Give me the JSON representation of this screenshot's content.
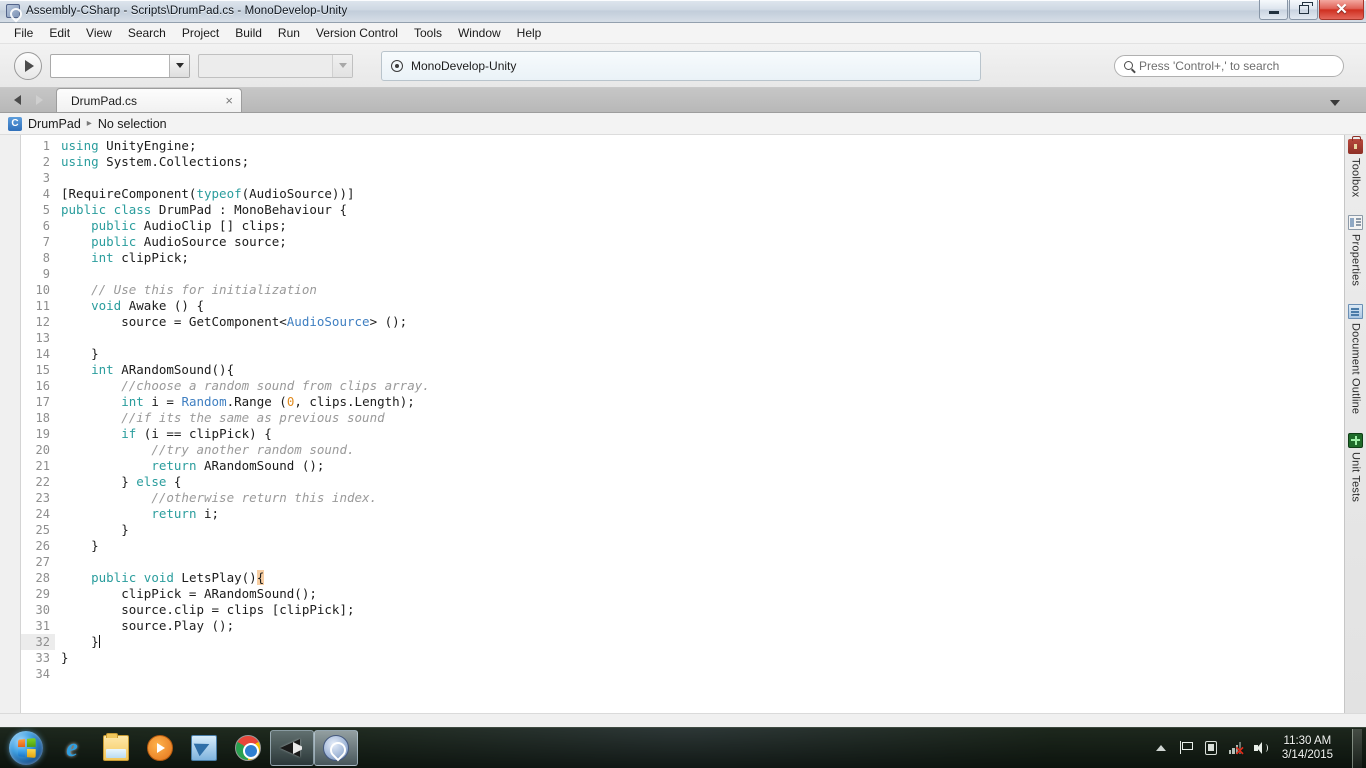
{
  "window": {
    "title": "Assembly-CSharp - Scripts\\DrumPad.cs - MonoDevelop-Unity",
    "icon": "monodevelop-icon",
    "minimize_label": "",
    "maximize_label": "",
    "close_label": "✕"
  },
  "menubar": {
    "items": [
      "File",
      "Edit",
      "View",
      "Search",
      "Project",
      "Build",
      "Run",
      "Version Control",
      "Tools",
      "Window",
      "Help"
    ]
  },
  "toolbar": {
    "run_button": "run-button",
    "configuration_combo": {
      "value": "",
      "enabled": true
    },
    "platform_combo": {
      "value": "",
      "enabled": false
    },
    "status_strip": {
      "icon": "target-icon",
      "text": "MonoDevelop-Unity"
    },
    "search": {
      "placeholder": "Press 'Control+,' to search",
      "value": "",
      "icon": "search-icon"
    }
  },
  "tabstrip": {
    "back_arrow": "navigate-back",
    "forward_arrow": "navigate-forward",
    "tabs": [
      {
        "label": "DrumPad.cs",
        "close": "×",
        "active": true
      }
    ],
    "overflow": "chevron-down-icon"
  },
  "breadcrumb": {
    "class_icon": "C",
    "class_name": "DrumPad",
    "separator": "▸",
    "member": "No selection"
  },
  "right_dock": {
    "items": [
      {
        "label": "Toolbox",
        "icon": "toolbox-icon"
      },
      {
        "label": "Properties",
        "icon": "properties-icon"
      },
      {
        "label": "Document Outline",
        "icon": "document-outline-icon"
      },
      {
        "label": "Unit Tests",
        "icon": "unit-tests-icon"
      }
    ]
  },
  "editor": {
    "current_line": 32,
    "total_lines": 34,
    "colors": {
      "keyword": "#2a9d9d",
      "type": "#3f7fc1",
      "number": "#e08a1e",
      "comment": "#9a9a9a",
      "text": "#1c1c1c",
      "brace_match_bg": "#f8cfa4",
      "background": "#ffffff",
      "line_number": "#8e8e8e"
    },
    "lines": [
      {
        "n": 1,
        "tokens": [
          {
            "t": "using",
            "c": "kw"
          },
          {
            "t": " UnityEngine;",
            "c": ""
          }
        ]
      },
      {
        "n": 2,
        "tokens": [
          {
            "t": "using",
            "c": "kw"
          },
          {
            "t": " System.Collections;",
            "c": ""
          }
        ]
      },
      {
        "n": 3,
        "tokens": []
      },
      {
        "n": 4,
        "tokens": [
          {
            "t": "[RequireComponent(",
            "c": ""
          },
          {
            "t": "typeof",
            "c": "kw"
          },
          {
            "t": "(AudioSource))]",
            "c": ""
          }
        ]
      },
      {
        "n": 5,
        "tokens": [
          {
            "t": "public class",
            "c": "kw"
          },
          {
            "t": " DrumPad : MonoBehaviour {",
            "c": ""
          }
        ]
      },
      {
        "n": 6,
        "tokens": [
          {
            "t": "    ",
            "c": ""
          },
          {
            "t": "public",
            "c": "kw"
          },
          {
            "t": " AudioClip [] clips;",
            "c": ""
          }
        ]
      },
      {
        "n": 7,
        "tokens": [
          {
            "t": "    ",
            "c": ""
          },
          {
            "t": "public",
            "c": "kw"
          },
          {
            "t": " AudioSource source;",
            "c": ""
          }
        ]
      },
      {
        "n": 8,
        "tokens": [
          {
            "t": "    ",
            "c": ""
          },
          {
            "t": "int",
            "c": "kw"
          },
          {
            "t": " clipPick;",
            "c": ""
          }
        ]
      },
      {
        "n": 9,
        "tokens": []
      },
      {
        "n": 10,
        "tokens": [
          {
            "t": "    ",
            "c": ""
          },
          {
            "t": "// Use this for initialization",
            "c": "cmt"
          }
        ]
      },
      {
        "n": 11,
        "tokens": [
          {
            "t": "    ",
            "c": ""
          },
          {
            "t": "void",
            "c": "kw"
          },
          {
            "t": " Awake () {",
            "c": ""
          }
        ]
      },
      {
        "n": 12,
        "tokens": [
          {
            "t": "        source = GetComponent<",
            "c": ""
          },
          {
            "t": "AudioSource",
            "c": "typ"
          },
          {
            "t": "> ();",
            "c": ""
          }
        ]
      },
      {
        "n": 13,
        "tokens": []
      },
      {
        "n": 14,
        "tokens": [
          {
            "t": "    }",
            "c": ""
          }
        ]
      },
      {
        "n": 15,
        "tokens": [
          {
            "t": "    ",
            "c": ""
          },
          {
            "t": "int",
            "c": "kw"
          },
          {
            "t": " ARandomSound(){",
            "c": ""
          }
        ]
      },
      {
        "n": 16,
        "tokens": [
          {
            "t": "        ",
            "c": ""
          },
          {
            "t": "//choose a random sound from clips array.",
            "c": "cmt"
          }
        ]
      },
      {
        "n": 17,
        "tokens": [
          {
            "t": "        ",
            "c": ""
          },
          {
            "t": "int",
            "c": "kw"
          },
          {
            "t": " i = ",
            "c": ""
          },
          {
            "t": "Random",
            "c": "typ"
          },
          {
            "t": ".Range (",
            "c": ""
          },
          {
            "t": "0",
            "c": "num"
          },
          {
            "t": ", clips.Length);",
            "c": ""
          }
        ]
      },
      {
        "n": 18,
        "tokens": [
          {
            "t": "        ",
            "c": ""
          },
          {
            "t": "//if its the same as previous sound",
            "c": "cmt"
          }
        ]
      },
      {
        "n": 19,
        "tokens": [
          {
            "t": "        ",
            "c": ""
          },
          {
            "t": "if",
            "c": "kw"
          },
          {
            "t": " (i == clipPick) {",
            "c": ""
          }
        ]
      },
      {
        "n": 20,
        "tokens": [
          {
            "t": "            ",
            "c": ""
          },
          {
            "t": "//try another random sound.",
            "c": "cmt"
          }
        ]
      },
      {
        "n": 21,
        "tokens": [
          {
            "t": "            ",
            "c": ""
          },
          {
            "t": "return",
            "c": "kw"
          },
          {
            "t": " ARandomSound ();",
            "c": ""
          }
        ]
      },
      {
        "n": 22,
        "tokens": [
          {
            "t": "        } ",
            "c": ""
          },
          {
            "t": "else",
            "c": "kw"
          },
          {
            "t": " {",
            "c": ""
          }
        ]
      },
      {
        "n": 23,
        "tokens": [
          {
            "t": "            ",
            "c": ""
          },
          {
            "t": "//otherwise return this index.",
            "c": "cmt"
          }
        ]
      },
      {
        "n": 24,
        "tokens": [
          {
            "t": "            ",
            "c": ""
          },
          {
            "t": "return",
            "c": "kw"
          },
          {
            "t": " i;",
            "c": ""
          }
        ]
      },
      {
        "n": 25,
        "tokens": [
          {
            "t": "        }",
            "c": ""
          }
        ]
      },
      {
        "n": 26,
        "tokens": [
          {
            "t": "    }",
            "c": ""
          }
        ]
      },
      {
        "n": 27,
        "tokens": []
      },
      {
        "n": 28,
        "tokens": [
          {
            "t": "    ",
            "c": ""
          },
          {
            "t": "public void",
            "c": "kw"
          },
          {
            "t": " LetsPlay()",
            "c": ""
          },
          {
            "t": "{",
            "c": "brc"
          }
        ]
      },
      {
        "n": 29,
        "tokens": [
          {
            "t": "        clipPick = ARandomSound();",
            "c": ""
          }
        ]
      },
      {
        "n": 30,
        "tokens": [
          {
            "t": "        source.clip = clips [clipPick];",
            "c": ""
          }
        ]
      },
      {
        "n": 31,
        "tokens": [
          {
            "t": "        source.Play ();",
            "c": ""
          }
        ]
      },
      {
        "n": 32,
        "tokens": [
          {
            "t": "    }",
            "c": ""
          }
        ],
        "caret": true,
        "current": true
      },
      {
        "n": 33,
        "tokens": [
          {
            "t": "}",
            "c": ""
          }
        ]
      },
      {
        "n": 34,
        "tokens": []
      }
    ]
  },
  "taskbar": {
    "start": "start-orb",
    "launchers": [
      {
        "name": "internet-explorer",
        "label": "e"
      },
      {
        "name": "windows-explorer",
        "label": ""
      },
      {
        "name": "windows-media-player",
        "label": ""
      },
      {
        "name": "remote-desktop",
        "label": ""
      },
      {
        "name": "google-chrome",
        "label": ""
      },
      {
        "name": "unity",
        "label": "",
        "active": true
      },
      {
        "name": "monodevelop",
        "label": "",
        "active": true,
        "focused": true
      }
    ],
    "tray": [
      {
        "name": "show-hidden-icons",
        "icon": "chevron-up-icon"
      },
      {
        "name": "action-center",
        "icon": "flag-icon"
      },
      {
        "name": "power",
        "icon": "plug-icon"
      },
      {
        "name": "network",
        "icon": "network-icon",
        "status": "disconnected"
      },
      {
        "name": "volume",
        "icon": "speaker-icon"
      }
    ],
    "clock": {
      "time": "11:30 AM",
      "date": "3/14/2015"
    }
  }
}
